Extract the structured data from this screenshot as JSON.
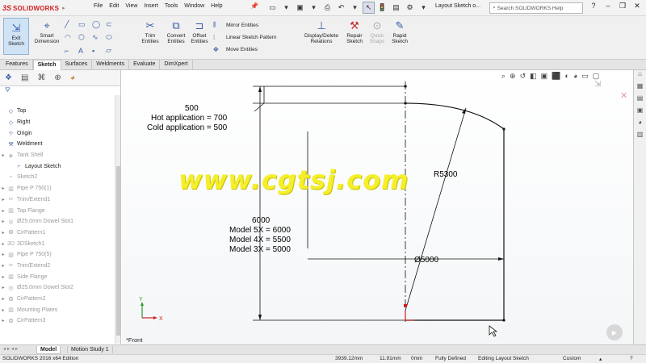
{
  "app": {
    "brand_prefix": "3S",
    "brand_name": "SOLIDWORKS",
    "document_title": "Layout Sketch o...",
    "search_placeholder": "Search SOLIDWORKS Help"
  },
  "menu": [
    "File",
    "Edit",
    "View",
    "Insert",
    "Tools",
    "Window",
    "Help"
  ],
  "command_manager": {
    "exit_sketch": "Exit Sketch",
    "smart_dimension": "Smart Dimension",
    "trim_entities": "Trim Entities",
    "convert_entities": "Convert Entities",
    "offset_entities": "Offset Entities",
    "mirror_entities": "Mirror Entities",
    "linear_sketch_pattern": "Linear Sketch Pattern",
    "move_entities": "Move Entities",
    "display_delete_relations": "Display/Delete Relations",
    "repair_sketch": "Repair Sketch",
    "quick_snaps": "Quick Snaps",
    "rapid_sketch": "Rapid Sketch"
  },
  "tabs": [
    "Features",
    "Sketch",
    "Surfaces",
    "Weldments",
    "Evaluate",
    "DimXpert"
  ],
  "active_tab": "Sketch",
  "tree": [
    {
      "label": "Top",
      "icon": "plane-icon",
      "dim": false
    },
    {
      "label": "Right",
      "icon": "plane-icon",
      "dim": false
    },
    {
      "label": "Origin",
      "icon": "origin-icon",
      "dim": false
    },
    {
      "label": "Weldment",
      "icon": "weldment-icon",
      "dim": false
    },
    {
      "label": "Tank Shell",
      "icon": "feature-icon",
      "dim": true
    },
    {
      "label": "Layout Sketch",
      "icon": "sketch-icon",
      "dim": false
    },
    {
      "label": "Sketch2",
      "icon": "sketch-icon",
      "dim": true
    },
    {
      "label": "Pipe P 750(1)",
      "icon": "structure-icon",
      "dim": true
    },
    {
      "label": "Trim/Extend1",
      "icon": "trim-icon",
      "dim": true
    },
    {
      "label": "Top Flange",
      "icon": "structure-icon",
      "dim": true
    },
    {
      "label": "Ø25.0mm Dowel Slot1",
      "icon": "hole-icon",
      "dim": true
    },
    {
      "label": "CirPattern1",
      "icon": "pattern-icon",
      "dim": true
    },
    {
      "label": "3DSketch1",
      "icon": "3dsketch-icon",
      "dim": true
    },
    {
      "label": "Pipe P 750(5)",
      "icon": "structure-icon",
      "dim": true
    },
    {
      "label": "Trim/Extend2",
      "icon": "trim-icon",
      "dim": true
    },
    {
      "label": "Side Flange",
      "icon": "structure-icon",
      "dim": true
    },
    {
      "label": "Ø25.0mm Dowel Slot2",
      "icon": "hole-icon",
      "dim": true
    },
    {
      "label": "CirPattern2",
      "icon": "pattern-icon",
      "dim": true
    },
    {
      "label": "Mounting Plates",
      "icon": "structure-icon",
      "dim": true
    },
    {
      "label": "CirPattern3",
      "icon": "pattern-icon",
      "dim": true
    }
  ],
  "sketch": {
    "dim_top": "500",
    "note_hot": "Hot application = 700",
    "note_cold": "Cold application = 500",
    "dim_height": "6000",
    "model_5x": "Model 5X = 6000",
    "model_4x": "Model 4X = 5500",
    "model_3x": "Model 3X = 5000",
    "dim_radius": "R5300",
    "dim_diameter": "Ø5000",
    "axis_y": "Y",
    "axis_x": "X"
  },
  "watermark": "www.cgtsj.com",
  "view_label": "*Front",
  "bottom_tabs": [
    "Model",
    "Motion Study 1"
  ],
  "status": {
    "edition": "SOLIDWORKS 2016 x64 Edition",
    "x": "3939.12mm",
    "y": "11.91mm",
    "z": "0mm",
    "state": "Fully Defined",
    "mode": "Editing Layout Sketch",
    "units": "Custom"
  }
}
